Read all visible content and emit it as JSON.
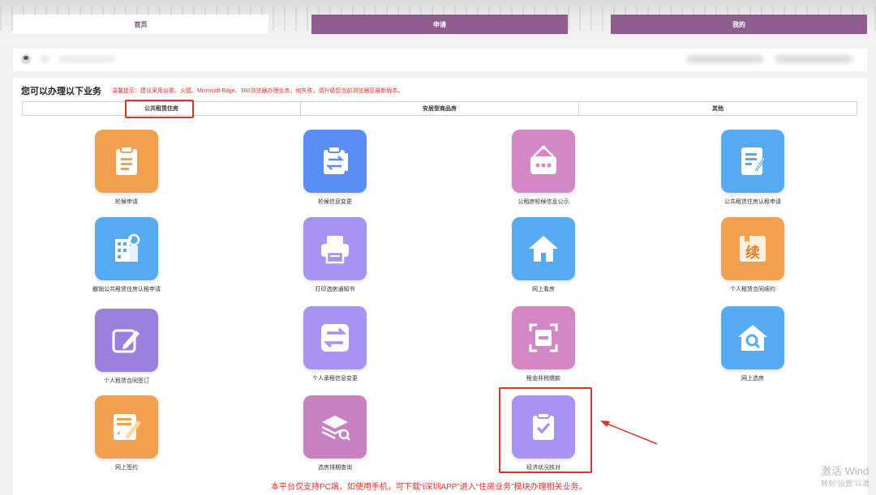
{
  "nav": {
    "home": "首页",
    "apply": "申请",
    "mine": "我的"
  },
  "panel": {
    "heading": "您可以办理以下业务",
    "hint": "温馨提示：建议采用谷歌、火狐、Microsoft Edge、360浏览器办理业务，如失败，请升级您当前浏览器至最新版本。",
    "tabs": [
      "公共租赁住房",
      "安居型商品房",
      "其他"
    ]
  },
  "tiles": [
    {
      "label": "轮候申请",
      "color": "#f0a04f",
      "icon": "clipboard-list-icon"
    },
    {
      "label": "轮候信息变更",
      "color": "#5b8ef5",
      "icon": "clipboard-swap-icon"
    },
    {
      "label": "公租房轮候信息公示",
      "color": "#d387c5",
      "icon": "hanging-sign-icon"
    },
    {
      "label": "公共租赁住房认租申请",
      "color": "#55aaf2",
      "icon": "document-edit-icon"
    },
    {
      "label": "撤销公共租赁住房认租申请",
      "color": "#55aaf2",
      "icon": "building-undo-icon"
    },
    {
      "label": "打印选房通知书",
      "color": "#a892f2",
      "icon": "printer-icon"
    },
    {
      "label": "网上看房",
      "color": "#55aaf2",
      "icon": "house-icon"
    },
    {
      "label": "个人租赁合同续约",
      "color": "#f0a04f",
      "icon": "renew-book-icon",
      "icon_text": "续"
    },
    {
      "label": "个人租赁合同签订",
      "color": "#9a80dc",
      "icon": "edit-square-icon"
    },
    {
      "label": "个人承租信息变更",
      "color": "#a892f2",
      "icon": "swap-arrows-icon"
    },
    {
      "label": "租金非税缴款",
      "color": "#d387c5",
      "icon": "scan-minus-icon"
    },
    {
      "label": "网上选房",
      "color": "#55aaf2",
      "icon": "house-search-icon"
    },
    {
      "label": "网上签约",
      "color": "#f0a04f",
      "icon": "contract-sign-icon"
    },
    {
      "label": "选房排期查询",
      "color": "#c780c0",
      "icon": "layers-search-icon"
    },
    {
      "label": "经济状况核对",
      "color": "#a892f2",
      "icon": "clipboard-check-icon"
    }
  ],
  "footer": {
    "note": "本平台仅支持PC端，如使用手机，可下载“i深圳APP”进入“住房业务”模块办理相关业务。"
  },
  "watermark": {
    "line1": "激活 Wind",
    "line2": "转到“设置”以激"
  },
  "colors": {
    "nav_purple": "#8e5c8e",
    "highlight_red": "#e0302a"
  }
}
